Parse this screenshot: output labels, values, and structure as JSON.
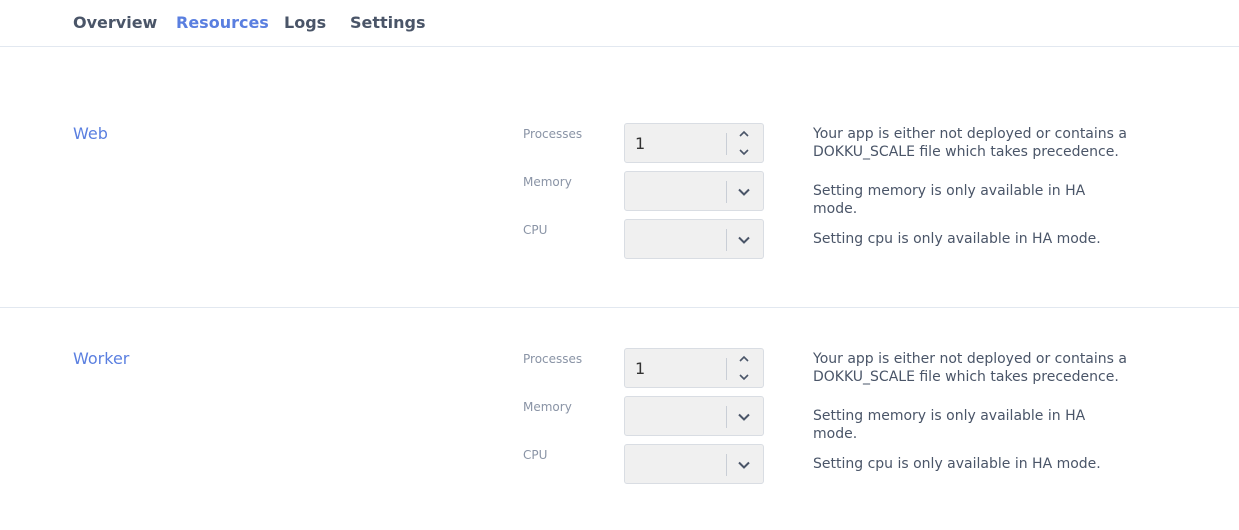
{
  "tabs": [
    {
      "label": "Overview"
    },
    {
      "label": "Resources",
      "active": true
    },
    {
      "label": "Logs"
    },
    {
      "label": "Settings"
    }
  ],
  "colors": {
    "accent": "#5a7fe0",
    "text": "#4a5568",
    "muted": "#8a94a6"
  },
  "web": {
    "title": "Web",
    "processes_label": "Processes",
    "processes_value": "1",
    "processes_help": "Your app is either not deployed or contains a DOKKU_SCALE file which takes precedence.",
    "memory_label": "Memory",
    "memory_help": "Setting memory is only available in HA mode.",
    "cpu_label": "CPU",
    "cpu_help": "Setting cpu is only available in HA mode."
  },
  "worker": {
    "title": "Worker",
    "processes_label": "Processes",
    "processes_value": "1",
    "processes_help": "Your app is either not deployed or contains a DOKKU_SCALE file which takes precedence.",
    "memory_label": "Memory",
    "memory_help": "Setting memory is only available in HA mode.",
    "cpu_label": "CPU",
    "cpu_help": "Setting cpu is only available in HA mode."
  }
}
